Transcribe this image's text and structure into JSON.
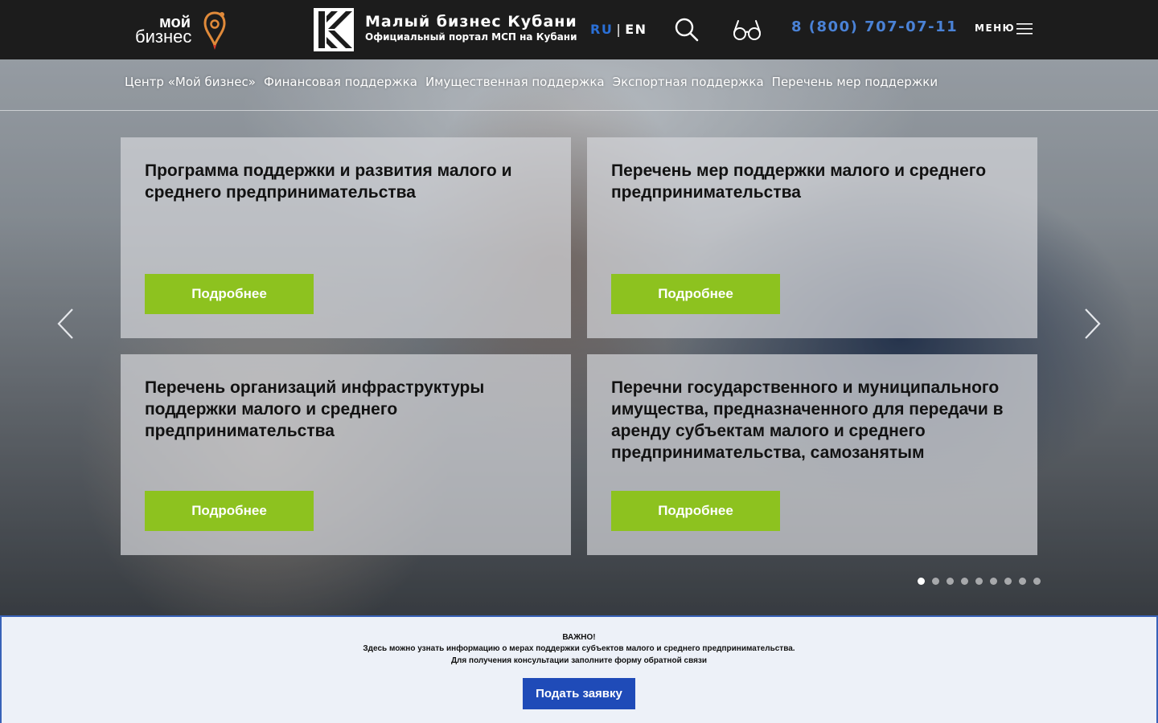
{
  "header": {
    "logo_my_line1": "мой",
    "logo_my_line2": "бизнес",
    "brand_title": "Малый бизнес Кубани",
    "brand_subtitle": "Официальный портал МСП на Кубани",
    "lang_ru": "RU",
    "lang_sep": "|",
    "lang_en": "EN",
    "phone": "8 (800) 707-07-11",
    "menu_label": "МЕНЮ",
    "search_icon": "search-icon",
    "accessibility_icon": "glasses-icon"
  },
  "nav": {
    "items": [
      "Центр «Мой бизнес»",
      "Финансовая поддержка",
      "Имущественная поддержка",
      "Экспортная поддержка",
      "Перечень мер поддержки"
    ]
  },
  "cards": [
    {
      "title": "Программа поддержки и развития малого и среднего предпринимательства",
      "button": "Подробнее"
    },
    {
      "title": "Перечень мер поддержки малого и среднего предпринимательства",
      "button": "Подробнее"
    },
    {
      "title": "Перечень организаций инфраструктуры поддержки малого и среднего предпринимательства",
      "button": "Подробнее"
    },
    {
      "title": "Перечни государственного и муниципального имущества, предназначенного для передачи в аренду субъектам малого и среднего предпринимательства, самозанятым",
      "button": "Подробнее"
    }
  ],
  "slider": {
    "total_slides": 9,
    "active_slide": 1
  },
  "notice": {
    "line1": "ВАЖНО!",
    "line2": "Здесь можно узнать информацию о мерах поддержки субъектов малого и среднего предпринимательства.",
    "line3": "Для получения консультации заполните форму обратной связи",
    "button": "Подать заявку"
  },
  "colors": {
    "header_bg": "#1c1c1c",
    "accent_green": "#8dc21f",
    "accent_blue": "#2a6fd6",
    "phone_blue": "#4a82d6",
    "notice_button": "#1f4bb8",
    "logo_pin_orange": "#e08a3a"
  }
}
